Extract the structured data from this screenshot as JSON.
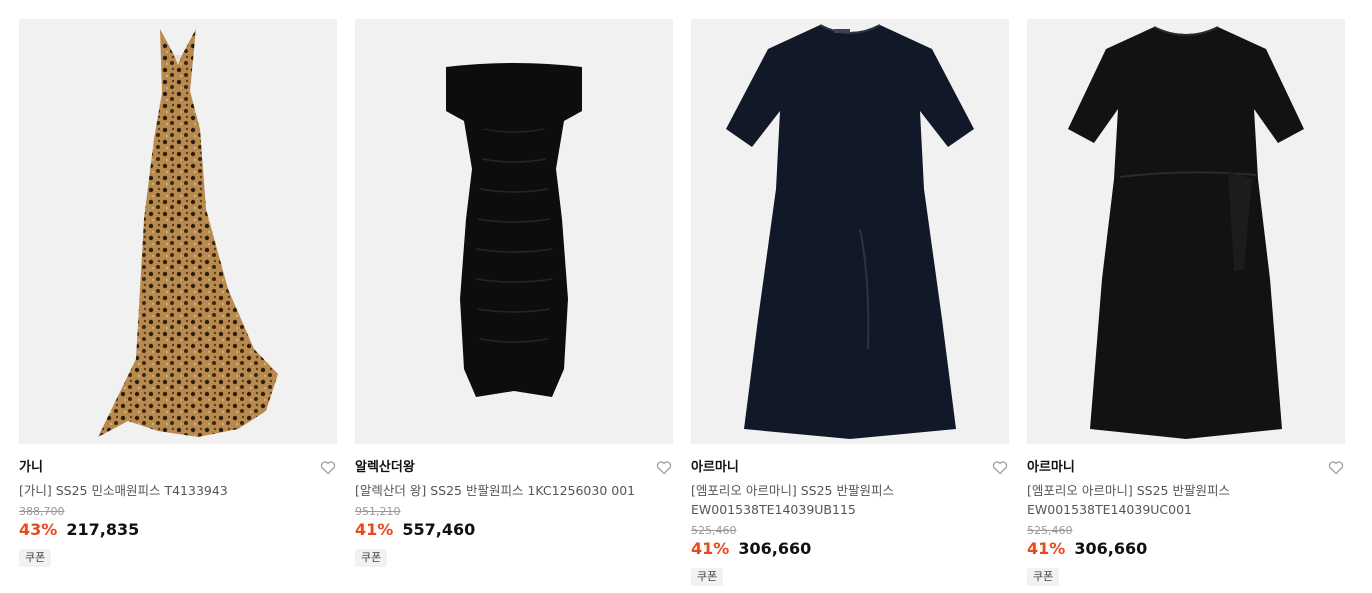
{
  "products": [
    {
      "image": "leopard-print-sleeveless-maxi-dress",
      "brand": "가니",
      "name": "[가니] SS25 민소매원피스 T4133943",
      "original_price": "388,700",
      "discount": "43%",
      "price": "217,835",
      "badge": "쿠폰"
    },
    {
      "image": "black-off-shoulder-ruched-dress",
      "brand": "알렉산더왕",
      "name": "[알렉산더 왕] SS25 반팔원피스 1KC1256030 001",
      "original_price": "951,210",
      "discount": "41%",
      "price": "557,460",
      "badge": "쿠폰"
    },
    {
      "image": "navy-short-sleeve-shift-dress",
      "brand": "아르마니",
      "name": "[엠포리오 아르마니] SS25 반팔원피스 EW001538TE14039UB115",
      "original_price": "525,460",
      "discount": "41%",
      "price": "306,660",
      "badge": "쿠폰"
    },
    {
      "image": "black-short-sleeve-tie-waist-dress",
      "brand": "아르마니",
      "name": "[엠포리오 아르마니] SS25 반팔원피스 EW001538TE14039UC001",
      "original_price": "525,460",
      "discount": "41%",
      "price": "306,660",
      "badge": "쿠폰"
    }
  ],
  "icons": {
    "wishlist": "heart-outline-icon"
  },
  "colors": {
    "discount": "#e8491d",
    "image_bg": "#f1f1f1",
    "badge_bg": "#f2f2f2"
  }
}
